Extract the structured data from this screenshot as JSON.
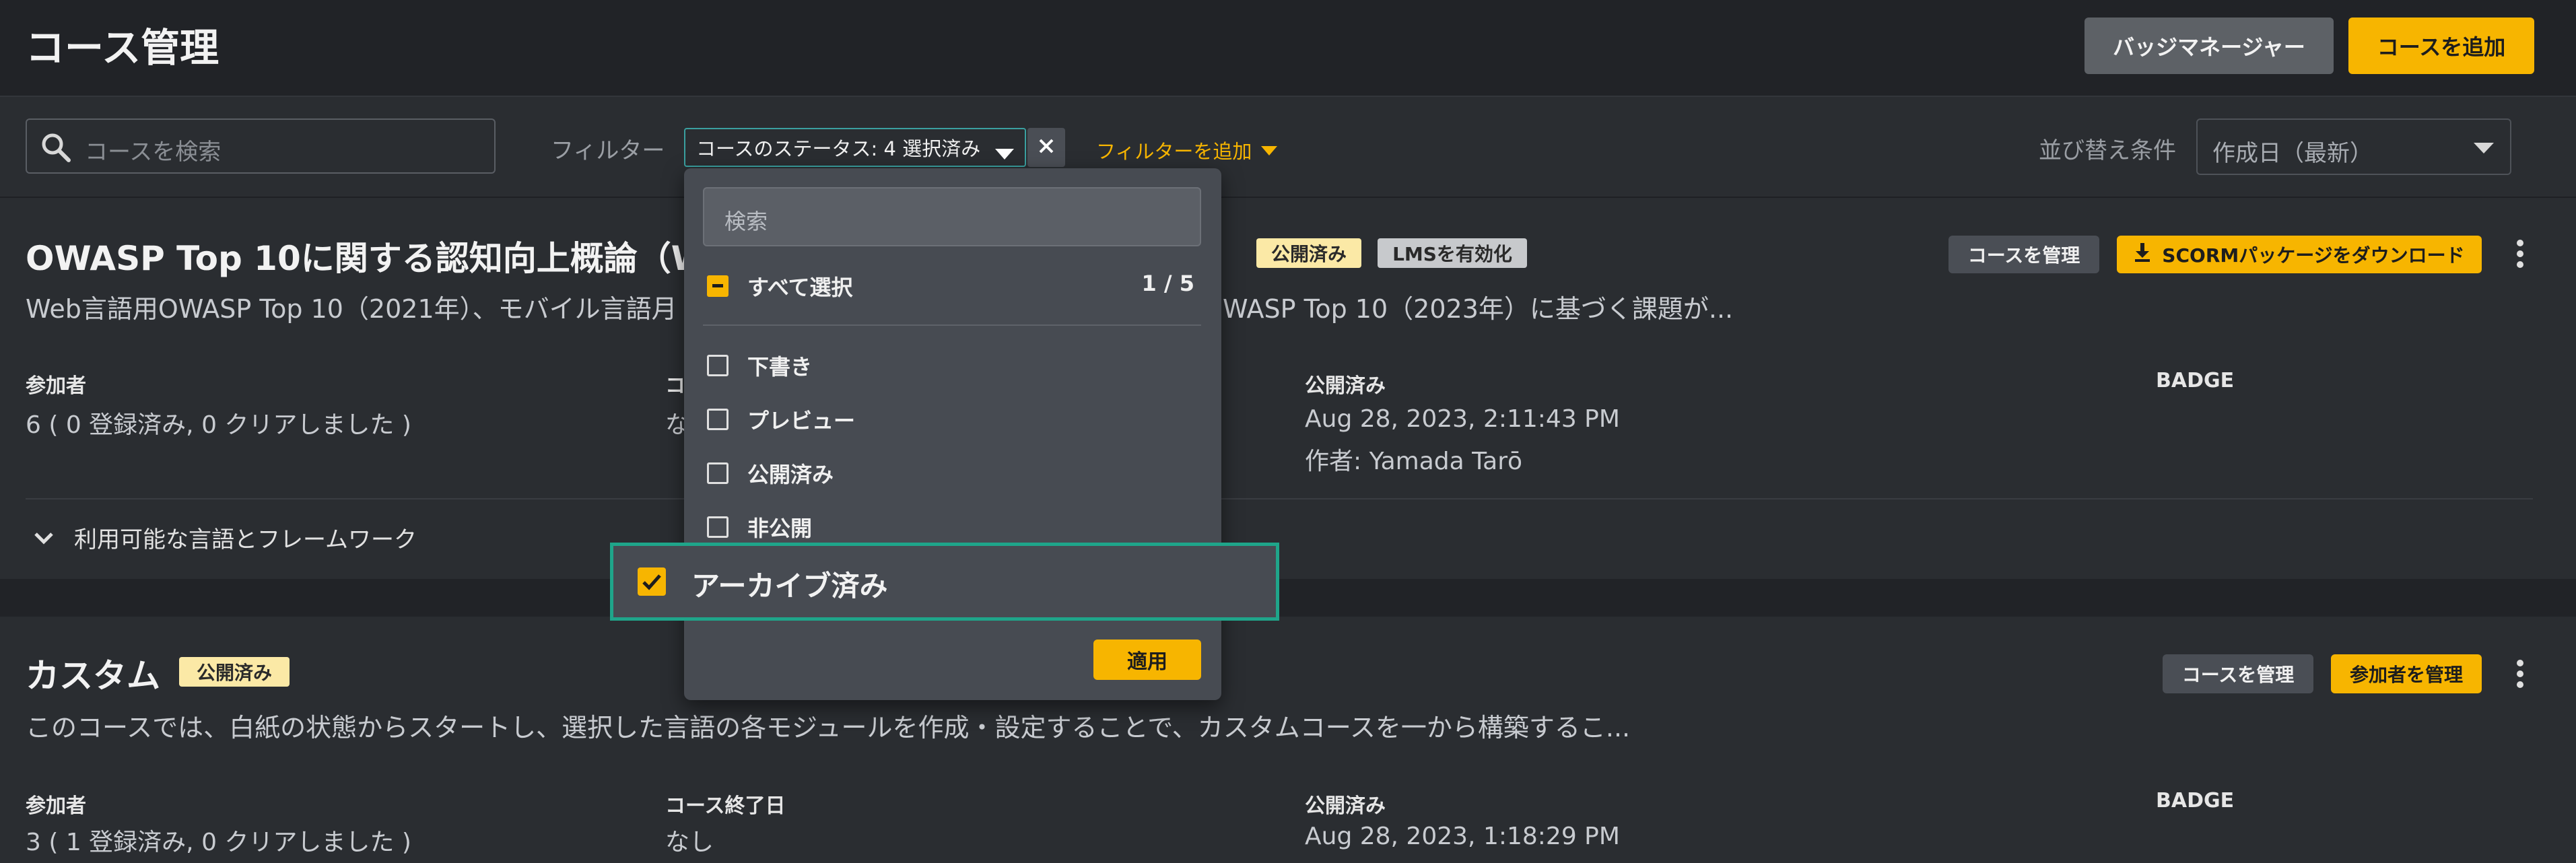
{
  "header": {
    "title": "コース管理",
    "badge_manager_label": "バッジマネージャー",
    "add_course_label": "コースを追加"
  },
  "filterbar": {
    "search_placeholder": "コースを検索",
    "filter_label": "フィルター",
    "status_chip_label": "コースのステータス: 4 選択済み",
    "add_filter_label": "フィルターを追加",
    "sort_label": "並び替え条件",
    "sort_value": "作成日（最新）"
  },
  "dropdown": {
    "search_placeholder": "検索",
    "select_all_label": "すべて選択",
    "count": "1 / 5",
    "options": [
      {
        "label": "下書き",
        "checked": false
      },
      {
        "label": "プレビュー",
        "checked": false
      },
      {
        "label": "公開済み",
        "checked": false
      },
      {
        "label": "非公開",
        "checked": false
      },
      {
        "label": "アーカイブ済み",
        "checked": true
      }
    ],
    "apply_label": "適用"
  },
  "courses": [
    {
      "title": "OWASP Top 10に関する認知向上概論（We",
      "badges": [
        "公開済み",
        "LMSを有効化"
      ],
      "description_left": "Web言語用OWASP Top 10（2021年）、モバイル言語月",
      "description_right": "WASP Top 10（2023年）に基づく課題が...",
      "manage_course_label": "コースを管理",
      "download_label": "SCORMパッケージをダウンロード",
      "participants_label": "参加者",
      "participants_value": "6 ( 0 登録済み, 0 クリアしました )",
      "end_label_partial": "コ",
      "end_value_partial": "な",
      "published_label": "公開済み",
      "published_value": "Aug 28, 2023, 2:11:43 PM",
      "author_value": "作者: Yamada Tarō",
      "badge_label": "BADGE",
      "expander_label": "利用可能な言語とフレームワーク"
    },
    {
      "title": "カスタム",
      "badges": [
        "公開済み"
      ],
      "description": "このコースでは、白紙の状態からスタートし、選択した言語の各モジュールを作成・設定することで、カスタムコースを一から構築するこ...",
      "manage_course_label": "コースを管理",
      "manage_participants_label": "参加者を管理",
      "participants_label": "参加者",
      "participants_value": "3 ( 1 登録済み, 0 クリアしました )",
      "end_label": "コース終了日",
      "end_value": "なし",
      "published_label": "公開済み",
      "published_value": "Aug 28, 2023, 1:18:29 PM",
      "badge_label": "BADGE"
    }
  ],
  "colors": {
    "accent": "#f7b500",
    "highlight_border": "#1fa58a",
    "chip_border": "#3aa0a0"
  }
}
